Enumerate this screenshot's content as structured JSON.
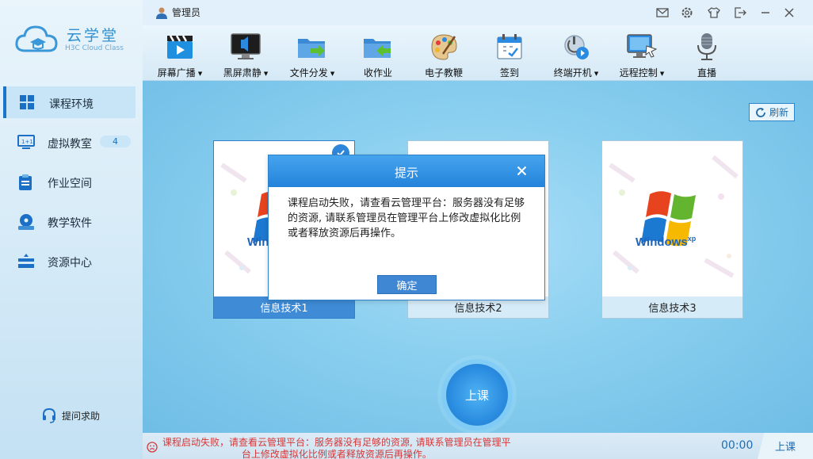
{
  "app": {
    "name": "云学堂",
    "name_en": "H3C Cloud Class",
    "user": "管理员"
  },
  "sidebar": {
    "items": [
      {
        "label": "课程环境",
        "icon": "windows-icon",
        "active": true
      },
      {
        "label": "虚拟教室",
        "icon": "virtual-classroom-icon",
        "badge": "4"
      },
      {
        "label": "作业空间",
        "icon": "clipboard-icon"
      },
      {
        "label": "教学软件",
        "icon": "software-disc-icon"
      },
      {
        "label": "资源中心",
        "icon": "resource-icon"
      }
    ],
    "help_label": "提问求助"
  },
  "toolbar": {
    "items": [
      {
        "label": "屏幕广播",
        "icon": "clapperboard-icon",
        "dropdown": true
      },
      {
        "label": "黑屏肃静",
        "icon": "black-screen-icon",
        "dropdown": true
      },
      {
        "label": "文件分发",
        "icon": "folder-send-icon",
        "dropdown": true
      },
      {
        "label": "收作业",
        "icon": "folder-receive-icon",
        "dropdown": false
      },
      {
        "label": "电子教鞭",
        "icon": "palette-icon",
        "dropdown": false
      },
      {
        "label": "签到",
        "icon": "calendar-check-icon",
        "dropdown": false
      },
      {
        "label": "终端开机",
        "icon": "power-on-icon",
        "dropdown": true
      },
      {
        "label": "远程控制",
        "icon": "remote-monitor-icon",
        "dropdown": true
      },
      {
        "label": "直播",
        "icon": "microphone-icon",
        "dropdown": false
      }
    ]
  },
  "main": {
    "refresh_label": "刷新",
    "courses": [
      {
        "label": "信息技术1",
        "selected": true
      },
      {
        "label": "信息技术2",
        "selected": false
      },
      {
        "label": "信息技术3",
        "selected": false
      }
    ],
    "windows_logo_text": "Windows",
    "windows_logo_sup": "xp",
    "start_class_label": "上课"
  },
  "dialog": {
    "title": "提示",
    "message": "课程启动失败，请查看云管理平台：服务器没有足够的资源, 请联系管理员在管理平台上修改虚拟化比例或者释放资源后再操作。",
    "ok_label": "确定"
  },
  "status": {
    "error_line1": "课程启动失败，请查看云管理平台：服务器没有足够的资源, 请联系管理员在管理平",
    "error_line2": "台上修改虚拟化比例或者释放资源后再操作。",
    "timer": "00:00",
    "class_label": "上课"
  },
  "colors": {
    "accent": "#2383da",
    "error": "#d63838",
    "selected_card": "#3f8bd6"
  }
}
